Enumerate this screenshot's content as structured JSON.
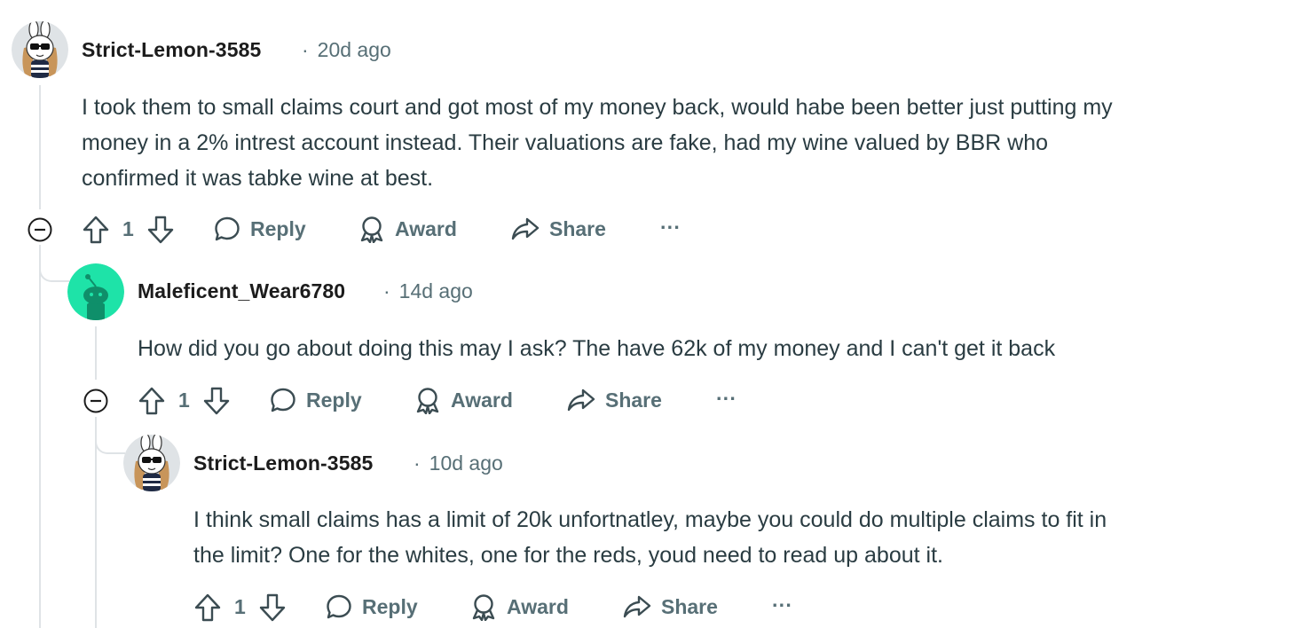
{
  "comments": [
    {
      "username": "Strict-Lemon-3585",
      "separator": "·",
      "time": "20d ago",
      "avatar": "bunny-sunglasses-avatar",
      "lines": [
        "I took them to small claims court and got most of my money back, would habe been better just putting my",
        "money in a 2% intrest account instead. Their valuations are fake, had my wine valued by BBR who",
        "confirmed it was tabke wine at best."
      ],
      "votes": "1",
      "reply_label": "Reply",
      "award_label": "Award",
      "share_label": "Share",
      "more_label": "···"
    },
    {
      "username": "Maleficent_Wear6780",
      "separator": "·",
      "time": "14d ago",
      "avatar": "snoo-default-avatar",
      "lines": [
        "How did you go about doing this may I ask? The have 62k of my money and I can't get it back"
      ],
      "votes": "1",
      "reply_label": "Reply",
      "award_label": "Award",
      "share_label": "Share",
      "more_label": "···"
    },
    {
      "username": "Strict-Lemon-3585",
      "separator": "·",
      "time": "10d ago",
      "avatar": "bunny-sunglasses-avatar",
      "lines": [
        "I think small claims has a limit of 20k unfortnatley, maybe you could do multiple claims to fit in",
        "the limit? One for the whites, one for the reds, youd need to read up about it."
      ],
      "votes": "1",
      "reply_label": "Reply",
      "award_label": "Award",
      "share_label": "Share",
      "more_label": "···"
    }
  ],
  "colors": {
    "text_primary": "#1c1c1c",
    "text_body": "#2a3c42",
    "text_meta": "#576f76",
    "thread_line": "#dfe3e6",
    "snoo_avatar_bg": "#1ee3a8"
  }
}
